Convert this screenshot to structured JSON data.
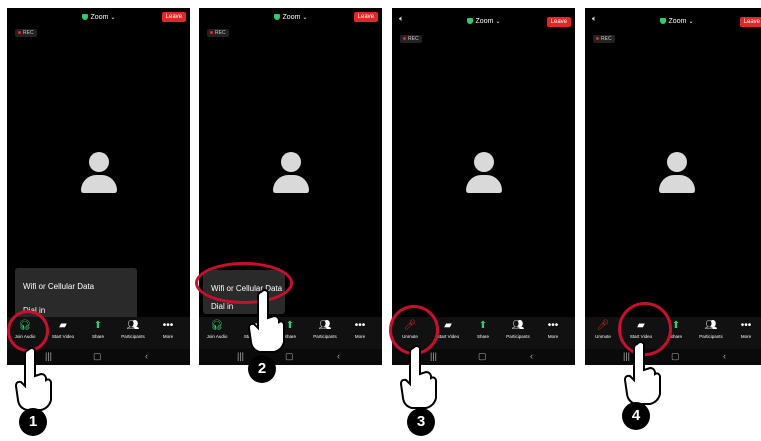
{
  "zoom_title": "Zoom",
  "leave_label": "Leave",
  "rec_label": "REC",
  "popup": {
    "wifi": "Wifi or Cellular Data",
    "dialin": "Dial in"
  },
  "panel1": {
    "join_audio": "Join Audio",
    "start_video": "Start Video",
    "share": "Share",
    "participants": "Participants",
    "more": "More"
  },
  "panel3": {
    "unmute": "Unmute",
    "start_video": "Start Video",
    "share": "Share",
    "participants": "Participants",
    "more": "More"
  },
  "steps": [
    "1",
    "2",
    "3",
    "4"
  ],
  "colors": {
    "accent_red": "#c8102e",
    "leave_red": "#e02828",
    "share_green": "#2ecc71"
  }
}
